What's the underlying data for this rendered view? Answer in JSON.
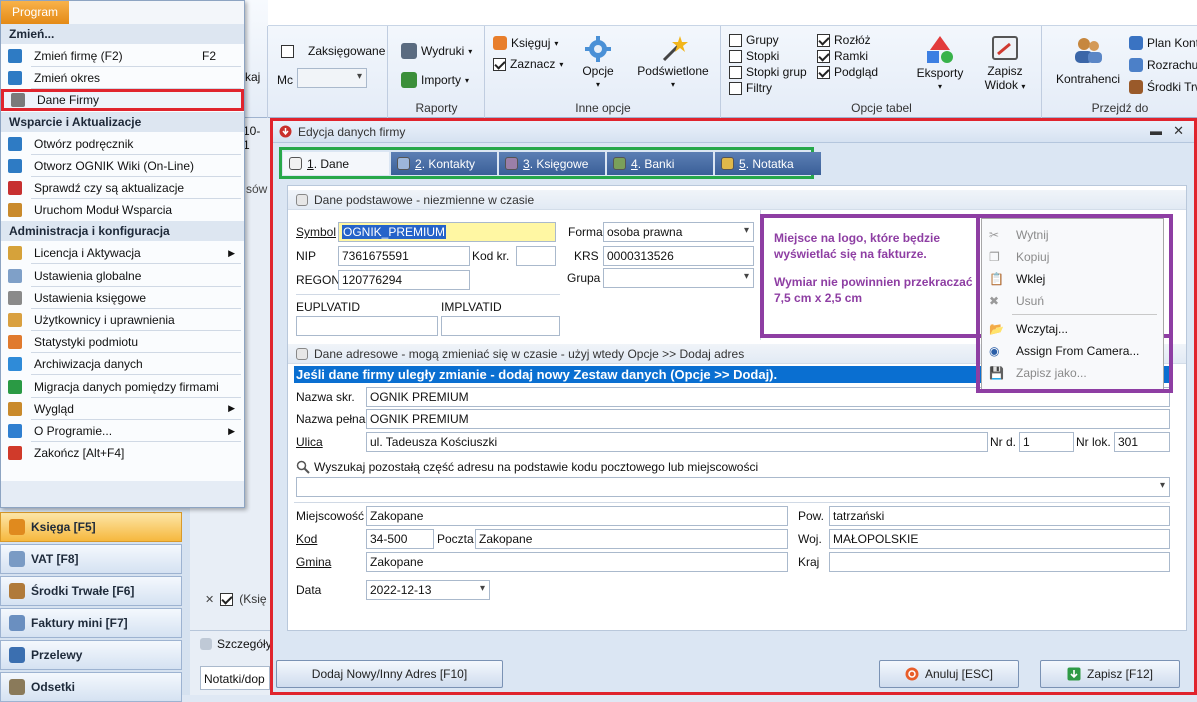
{
  "menu": {
    "tab": "Program",
    "sections": [
      {
        "header": "Zmień...",
        "items": [
          {
            "label": "Zmień firmę (F2)",
            "shortcut": "F2"
          },
          {
            "label": "Zmień okres"
          },
          {
            "label": "Dane Firmy",
            "highlighted": true
          }
        ]
      },
      {
        "header": "Wsparcie i Aktualizacje",
        "items": [
          {
            "label": "Otwórz podręcznik"
          },
          {
            "label": "Otworz OGNIK Wiki (On-Line)"
          },
          {
            "label": "Sprawdź czy są aktualizacje"
          },
          {
            "label": "Uruchom Moduł Wsparcia"
          }
        ]
      },
      {
        "header": "Administracja i konfiguracja",
        "items": [
          {
            "label": "Licencja i Aktywacja",
            "submenu": true
          },
          {
            "label": "Ustawienia globalne"
          },
          {
            "label": "Ustawienia księgowe"
          },
          {
            "label": "Użytkownicy i uprawnienia"
          },
          {
            "label": "Statystyki podmiotu"
          },
          {
            "label": "Archiwizacja danych"
          },
          {
            "label": "Migracja danych pomiędzy firmami"
          },
          {
            "label": "Wygląd",
            "submenu": true
          },
          {
            "label": "O Programie...",
            "submenu": true
          },
          {
            "label": "Zakończ [Alt+F4]"
          }
        ]
      }
    ]
  },
  "ribbon": {
    "partial_kaj": "kaj",
    "zaksiegowane": "Zaksięgowane",
    "mc_label": "Mc",
    "wydruki": "Wydruki",
    "importy": "Importy",
    "raporty": "Raporty",
    "ksieguj": "Księguj",
    "zaznacz": "Zaznacz",
    "opcje": "Opcje",
    "podswietlone": "Podświetlone",
    "inne_opcje": "Inne opcje",
    "checks_left": [
      {
        "label": "Grupy",
        "checked": false
      },
      {
        "label": "Stopki",
        "checked": false
      },
      {
        "label": "Stopki grup",
        "checked": false
      },
      {
        "label": "Filtry",
        "checked": false
      }
    ],
    "checks_right": [
      {
        "label": "Rozłóż",
        "checked": true
      },
      {
        "label": "Ramki",
        "checked": true
      },
      {
        "label": "Podgląd",
        "checked": true
      }
    ],
    "eksporty": "Eksporty",
    "zapisz_widok_1": "Zapisz",
    "zapisz_widok_2": "Widok",
    "opcje_tabel": "Opcje tabel",
    "kontrahenci": "Kontrahenci",
    "plan_kont": "Plan Kont",
    "rozrachunki": "Rozrachu",
    "srodki_trwale": "Środki Trw",
    "przejdz_do": "Przejdź do"
  },
  "left": {
    "partial_date": "10-1",
    "partial_sow": "sów",
    "nav": [
      {
        "label": "Księga [F5]",
        "active": true
      },
      {
        "label": "VAT [F8]"
      },
      {
        "label": "Środki Trwałe [F6]"
      },
      {
        "label": "Faktury mini [F7]"
      },
      {
        "label": "Przelewy"
      },
      {
        "label": "Odsetki"
      }
    ],
    "ks_partial": "(Księ",
    "szczegoly": "Szczegóły",
    "notatki": "Notatki/dop"
  },
  "dialog": {
    "title": "Edycja danych firmy",
    "tabs": [
      {
        "num": "1",
        "label": ". Dane"
      },
      {
        "num": "2",
        "label": ". Kontakty"
      },
      {
        "num": "3",
        "label": ". Księgowe"
      },
      {
        "num": "4",
        "label": ". Banki"
      },
      {
        "num": "5",
        "label": ". Notatka"
      }
    ],
    "basic": {
      "header": "Dane podstawowe - niezmienne w czasie",
      "symbol_label": "Symbol",
      "symbol": "OGNIK_PREMIUM",
      "nip_label": "NIP",
      "nip": "7361675591",
      "kodkr_label": "Kod kr.",
      "kodkr": "",
      "regon_label": "REGON",
      "regon": "120776294",
      "eupl_label": "EUPLVATID",
      "impl_label": "IMPLVATID",
      "forma_label": "Forma",
      "forma": "osoba prawna",
      "krs_label": "KRS",
      "krs": "0000313526",
      "grupa_label": "Grupa",
      "grupa": ""
    },
    "logo": {
      "line1": "Miejsce na logo, które będzie",
      "line2": "wyświetlać się na fakturze.",
      "line3": "Wymiar nie powinnien przekraczać",
      "line4": "7,5 cm x 2,5 cm"
    },
    "context_menu": [
      {
        "label": "Wytnij",
        "disabled": true
      },
      {
        "label": "Kopiuj",
        "disabled": true
      },
      {
        "label": "Wklej",
        "disabled": false
      },
      {
        "label": "Usuń",
        "disabled": true
      },
      {
        "label": "Wczytaj...",
        "disabled": false
      },
      {
        "label": "Assign From Camera...",
        "disabled": false
      },
      {
        "label": "Zapisz jako...",
        "disabled": true
      }
    ],
    "address": {
      "header": "Dane adresowe - mogą zmieniać się w czasie - użyj wtedy Opcje >> Dodaj adres",
      "banner": "Jeśli dane firmy uległy zmianie - dodaj nowy Zestaw danych (Opcje >> Dodaj).",
      "nazwa_skr_label": "Nazwa skr.",
      "nazwa_skr": "OGNIK PREMIUM",
      "nazwa_pelna_label": "Nazwa pełna",
      "nazwa_pelna": "OGNIK PREMIUM",
      "ulica_label": "Ulica",
      "ulica": "ul. Tadeusza Kościuszki",
      "nrd_label": "Nr d.",
      "nrd": "1",
      "nrlok_label": "Nr lok.",
      "nrlok": "301",
      "search_label": "Wyszukaj pozostałą część adresu na podstawie kodu pocztowego lub miejscowości",
      "miejscowosc_label": "Miejscowość",
      "miejscowosc": "Zakopane",
      "pow_label": "Pow.",
      "pow": "tatrzański",
      "kod_label": "Kod",
      "kod": "34-500",
      "poczta_label": "Poczta",
      "poczta": "Zakopane",
      "woj_label": "Woj.",
      "woj": "MAŁOPOLSKIE",
      "gmina_label": "Gmina",
      "gmina": "Zakopane",
      "kraj_label": "Kraj",
      "kraj": "",
      "data_label": "Data",
      "data": "2022-12-13"
    },
    "buttons": {
      "add_address": "Dodaj Nowy/Inny Adres [F10]",
      "cancel": "Anuluj [ESC]",
      "save": "Zapisz [F12]"
    }
  },
  "colors": {
    "highlight_red": "#e0242d",
    "tab_green": "#27a84a",
    "logo_purple": "#8e3ea3",
    "banner_blue": "#0a6fd1"
  }
}
